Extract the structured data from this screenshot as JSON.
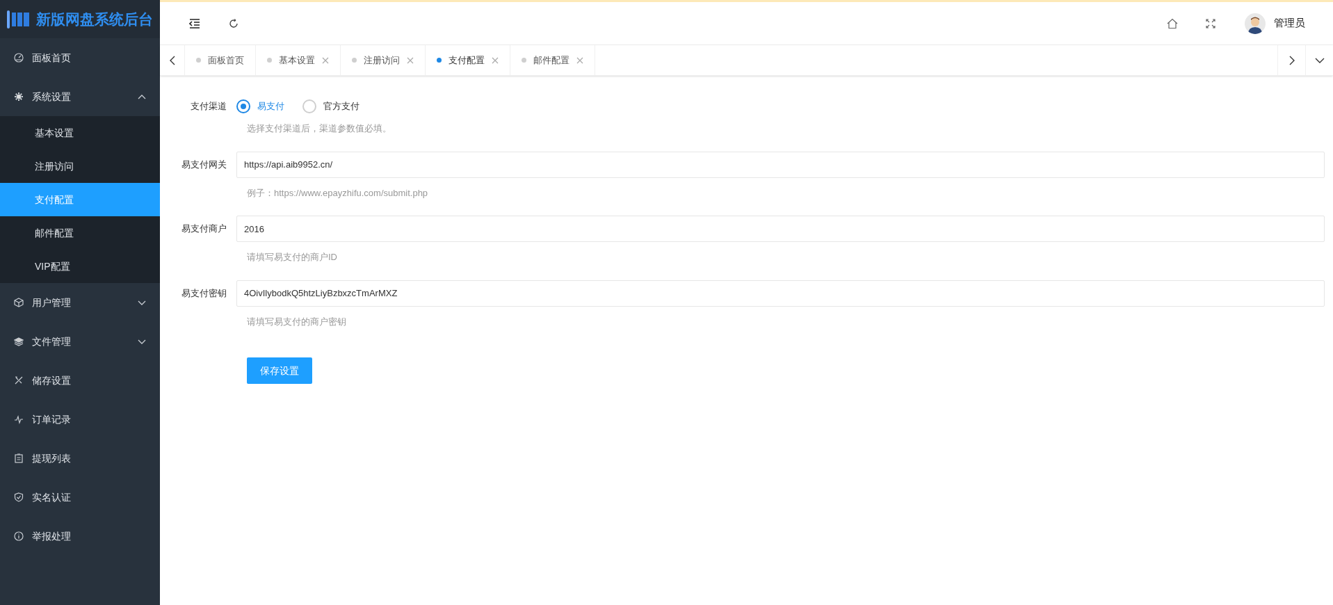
{
  "sidebar": {
    "logo": "新版网盘系统后台",
    "items": [
      {
        "kind": "link",
        "label": "面板首页"
      },
      {
        "kind": "group",
        "label": "系统设置",
        "expanded": true,
        "children": [
          {
            "label": "基本设置",
            "selected": false
          },
          {
            "label": "注册访问",
            "selected": false
          },
          {
            "label": "支付配置",
            "selected": true
          },
          {
            "label": "邮件配置",
            "selected": false
          },
          {
            "label": "VIP配置",
            "selected": false
          }
        ]
      },
      {
        "kind": "group",
        "label": "用户管理",
        "expanded": false
      },
      {
        "kind": "group",
        "label": "文件管理",
        "expanded": false
      },
      {
        "kind": "link",
        "label": "储存设置"
      },
      {
        "kind": "link",
        "label": "订单记录"
      },
      {
        "kind": "link",
        "label": "提现列表"
      },
      {
        "kind": "link",
        "label": "实名认证"
      },
      {
        "kind": "link",
        "label": "举报处理"
      }
    ]
  },
  "header": {
    "user": "管理员"
  },
  "tabs": [
    {
      "label": "面板首页",
      "selected": false,
      "closable": false
    },
    {
      "label": "基本设置",
      "selected": false,
      "closable": true
    },
    {
      "label": "注册访问",
      "selected": false,
      "closable": true
    },
    {
      "label": "支付配置",
      "selected": true,
      "closable": true
    },
    {
      "label": "邮件配置",
      "selected": false,
      "closable": true
    }
  ],
  "form": {
    "channel": {
      "label": "支付渠道",
      "options": [
        {
          "label": "易支付",
          "selected": true
        },
        {
          "label": "官方支付",
          "selected": false
        }
      ],
      "hint": "选择支付渠道后，渠道参数值必填。"
    },
    "fields": [
      {
        "label": "易支付网关",
        "value": "https://api.aib9952.cn/",
        "hint": "例子：https://www.epayzhifu.com/submit.php"
      },
      {
        "label": "易支付商户",
        "value": "2016",
        "hint": "请填写易支付的商户ID"
      },
      {
        "label": "易支付密钥",
        "value": "4OivIlybodkQ5htzLiyBzbxzcTmArMXZ",
        "hint": "请填写易支付的商户密钥"
      }
    ],
    "submit": "保存设置"
  }
}
